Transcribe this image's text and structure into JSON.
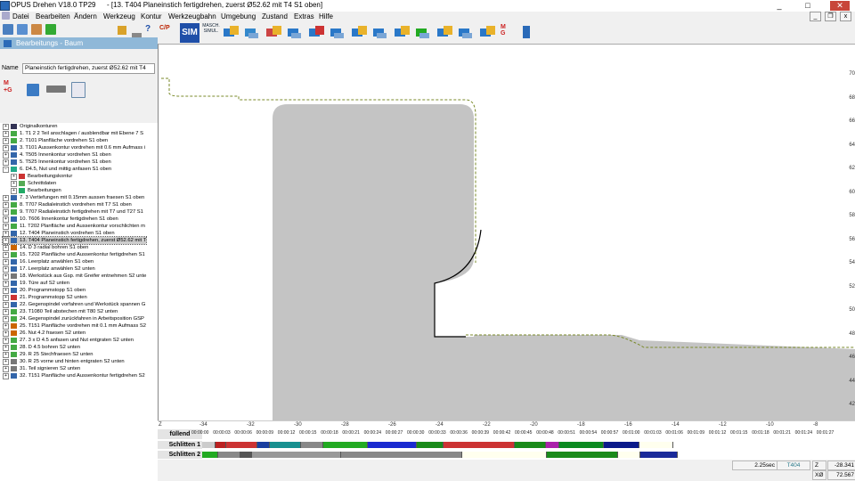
{
  "window": {
    "app_title": "OPUS Drehen V18.0   TP29",
    "doc_title": "- [13. T404 Planeinstich fertigdrehen, zuerst Ø52.62 mit T4 S1 oben]",
    "min": "_",
    "max": "□",
    "close": "✕"
  },
  "menu": [
    "Datei",
    "Bearbeiten",
    "Ändern",
    "Werkzeug",
    "Kontur",
    "Werkzeugbahn",
    "Umgebung",
    "Zustand",
    "Extras",
    "Hilfe"
  ],
  "mdi": [
    "_",
    "❐",
    "x"
  ],
  "toolbar": {
    "sim_label": "SIM",
    "masch_label": "MASCH. SIMUL.",
    "cp_label": "C/P"
  },
  "panel": {
    "title": "Bearbeitungs - Baum"
  },
  "name_field": {
    "label": "Name",
    "value": "Planeinstich fertigdrehen, zuerst Ø52.62 mit T4"
  },
  "tree": [
    "Originalkonturen",
    "1. T1 2 2 Teil anschlagen / ausblendbar mit Ebene 7  S",
    "2. T101 Planfläche vordrehen S1 oben",
    "3. T101 Aussenkontur vordrehen mit 0.6 mm Aufmass i",
    "4. T505 Innenkontur vordrehen S1 oben",
    "5. T525 Innenkontur vordrehen S1 oben",
    "6. D4.5, Nut und mittig anfasen S1 oben",
    "Bearbeitungskontur",
    "Schnittdaten",
    "Bearbeitungen",
    "7. 3 Vertiefungen mit 0.15mm aussen fraesen S1 oben",
    "8. T707 Radialeinstich vordrehen mit T7 S1 oben",
    "9. T707 Radialeinstich fertigdrehen mit T7 und T27 S1",
    "10. T606 Innenkontur fertigdrehen S1 oben",
    "11. T202 Planfläche und Aussenkontur vorschlichten m",
    "12. T404 Planeinstich vordrehen S1 oben",
    "13. T404 Planeinstich fertigdrehen, zuerst Ø52.62 mit T",
    "14. D 3 radial bohren S1 oben",
    "15. T202 Planfläche und Aussenkontur fertigdrehen S1",
    "16. Leerplatz anwählen S1 oben",
    "17. Leerplatz anwählen S2 unten",
    "18. Werkstück aus Gsp. mit Greifer entnehmen S2 unte",
    "19. Türe auf S2 unten",
    "20. Programmstopp S1 oben",
    "21. Programmstopp S2 unten",
    "22. Gegenspindel vorfahren und Werkstück spannen G",
    "23. T1080 Teil abstechen mit T80 S2 unten",
    "24. Gegenspindel zurückfahren in Arbeitsposition GSP",
    "25. T151 Planfläche vordrehen mit 0.1 mm Aufmass S2",
    "26. Nut 4.2 fraesen S2 unten",
    "27. 3 x D 4.5 anfasen und Nut entgraten S2 unten",
    "28. D 4.5 bohren S2 unten",
    "29. R 25 Stechfraesen S2 unten",
    "30. R 25 vorne und hinten entgraten S2 unten",
    "31. Teil signieren S2 unten",
    "32. T151 Planfläche und Aussenkontur fertigdrehen S2"
  ],
  "y_axis": [
    "70",
    "68",
    "66",
    "64",
    "62",
    "60",
    "58",
    "56",
    "54",
    "52",
    "50",
    "48",
    "46",
    "44",
    "42"
  ],
  "x_axis": [
    "Z",
    "-34",
    "-32",
    "-30",
    "-28",
    "-26",
    "-24",
    "-22",
    "-20",
    "-18",
    "-16",
    "-14",
    "-12",
    "-10",
    "-8"
  ],
  "timeline": {
    "header": "füllend",
    "rows": [
      "Schlitten 1",
      "Schlitten 2"
    ],
    "ticks": [
      "00:00:00",
      "00:00:03",
      "00:00:06",
      "00:00:09",
      "00:00:12",
      "00:00:15",
      "00:00:18",
      "00:00:21",
      "00:00:24",
      "00:00:27",
      "00:00:30",
      "00:00:33",
      "00:00:36",
      "00:00:39",
      "00:00:42",
      "00:00:45",
      "00:00:48",
      "00:00:51",
      "00:00:54",
      "00:00:57",
      "00:01:00",
      "00:01:03",
      "00:01:06",
      "00:01:09",
      "00:01:12",
      "00:01:15",
      "00:01:18",
      "00:01:21",
      "00:01:24",
      "00:01:27"
    ]
  },
  "status": {
    "time": "2.25sec",
    "tool": "T404",
    "z_label": "Z",
    "z_value": "-28.341",
    "x_label": "XØ",
    "x_value": "72.567"
  },
  "colors": {
    "part": "#c4c4c4",
    "path": "#7a8a2a",
    "accent": "#1f4fa8"
  }
}
